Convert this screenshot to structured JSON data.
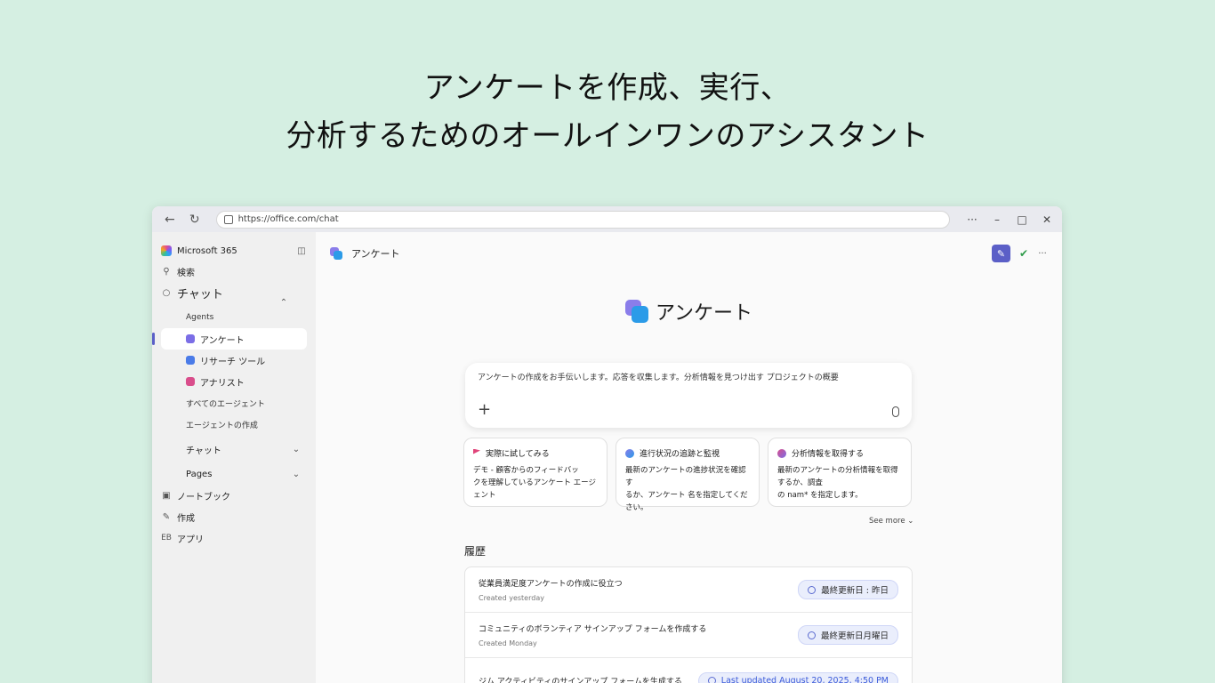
{
  "hero": {
    "line1": "アンケートを作成、実行、",
    "line2": "分析するためのオールインワンのアシスタント"
  },
  "browser": {
    "url": "https://office.com/chat"
  },
  "sidebar": {
    "brand": "Microsoft 365",
    "search": "検索",
    "chat": "チャット",
    "agents_label": "Agents",
    "agents": [
      {
        "label": "アンケート",
        "color": "#7b6ee6"
      },
      {
        "label": "リサーチ ツール",
        "color": "#4a7be8"
      },
      {
        "label": "アナリスト",
        "color": "#d94d8b"
      }
    ],
    "all_agents": "すべてのエージェント",
    "create_agent": "エージェントの作成",
    "chat_section": "チャット",
    "pages_section": "Pages",
    "notebook": "ノートブック",
    "create": "作成",
    "apps_icon": "EB",
    "apps": "アプリ"
  },
  "topbar": {
    "agent_name": "アンケート"
  },
  "main": {
    "title": "アンケート",
    "composer_placeholder": "アンケートの作成をお手伝いします。応答を収集します。分析情報を見つけ出す プロジェクトの概要",
    "cards": [
      {
        "title": "実際に試してみる",
        "body": "デモ - 顧客からのフィードバッ\nクを理解しているアンケート エージェント",
        "icon": "flag-icon"
      },
      {
        "title": "進行状況の追跡と監視",
        "body": "最新のアンケートの進捗状況を確認す\nるか、アンケート 名を指定してください。",
        "icon": "people-icon"
      },
      {
        "title": "分析情報を取得する",
        "body": "最新のアンケートの分析情報を取得するか、調査\nの nam* を指定します。",
        "icon": "insight-icon"
      }
    ],
    "see_more": "See more",
    "history_title": "履歴",
    "history": [
      {
        "title": "従業員満足度アンケートの作成に役立つ",
        "sub": "Created yesterday",
        "badge": "最終更新日 : 昨日"
      },
      {
        "title": "コミュニティのボランティア サインアップ フォームを作成する",
        "sub": "Created Monday",
        "badge": "最終更新日月曜日"
      },
      {
        "title": "ジム アクティビティのサインアップ フォームを生成する",
        "sub": "",
        "badge": "Last updated August 20, 2025, 4:50 PM"
      }
    ]
  }
}
